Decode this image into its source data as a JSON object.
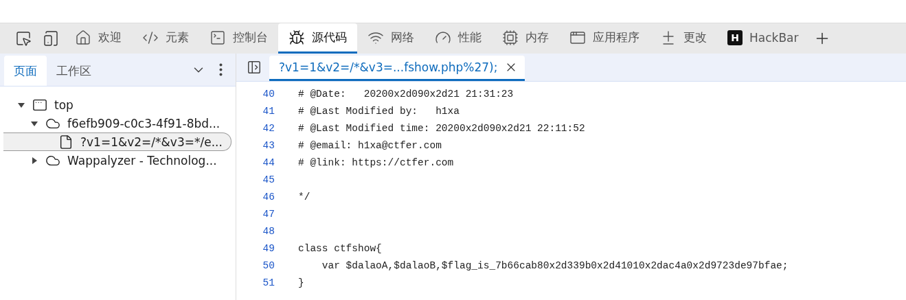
{
  "tools": [
    {
      "kind": "inspect"
    },
    {
      "kind": "device"
    }
  ],
  "tabs": [
    {
      "kind": "welcome",
      "label": "欢迎",
      "selected": false
    },
    {
      "kind": "elements",
      "label": "元素",
      "selected": false
    },
    {
      "kind": "console",
      "label": "控制台",
      "selected": false
    },
    {
      "kind": "sources",
      "label": "源代码",
      "selected": true
    },
    {
      "kind": "network",
      "label": "网络",
      "selected": false
    },
    {
      "kind": "performance",
      "label": "性能",
      "selected": false
    },
    {
      "kind": "memory",
      "label": "内存",
      "selected": false
    },
    {
      "kind": "application",
      "label": "应用程序",
      "selected": false
    },
    {
      "kind": "changes",
      "label": "更改",
      "selected": false
    },
    {
      "kind": "extension",
      "badge": "H",
      "label": "HackBar",
      "selected": false
    }
  ],
  "sidebar": {
    "tabs": [
      {
        "label": "页面",
        "selected": true
      },
      {
        "label": "工作区",
        "selected": false
      }
    ],
    "tree": [
      {
        "kind": "frame",
        "label": "top",
        "expanded": true,
        "selected": false,
        "children": [
          {
            "kind": "origin",
            "label": "f6efb909-c0c3-4f91-8bd...",
            "expanded": true,
            "selected": false,
            "children": [
              {
                "kind": "file",
                "label": "?v1=1&v2=/*&v3=*/e...",
                "selected": true
              }
            ]
          },
          {
            "kind": "origin",
            "label": "Wappalyzer - Technolog...",
            "expanded": false,
            "selected": false
          }
        ]
      }
    ]
  },
  "editor": {
    "file_tabs": [
      {
        "label": "?v1=1&v2=/*&v3=...fshow.php%27);",
        "selected": true
      }
    ],
    "lines": [
      {
        "number": "40",
        "text": "# @Date:   20200x2d090x2d21 21:31:23"
      },
      {
        "number": "41",
        "text": "# @Last Modified by:   h1xa"
      },
      {
        "number": "42",
        "text": "# @Last Modified time: 20200x2d090x2d21 22:11:52"
      },
      {
        "number": "43",
        "text": "# @email: h1xa@ctfer.com"
      },
      {
        "number": "44",
        "text": "# @link: https://ctfer.com"
      },
      {
        "number": "45"
      },
      {
        "number": "46",
        "text": "*/"
      },
      {
        "number": "47"
      },
      {
        "number": "48"
      },
      {
        "number": "49",
        "text": "class ctfshow{"
      },
      {
        "number": "50",
        "text": "    var $dalaoA,$dalaoB,$flag_is_7b66cab80x2d339b0x2d41010x2dac4a0x2d9723de97bfae;"
      },
      {
        "number": "51",
        "text": "}"
      }
    ]
  }
}
